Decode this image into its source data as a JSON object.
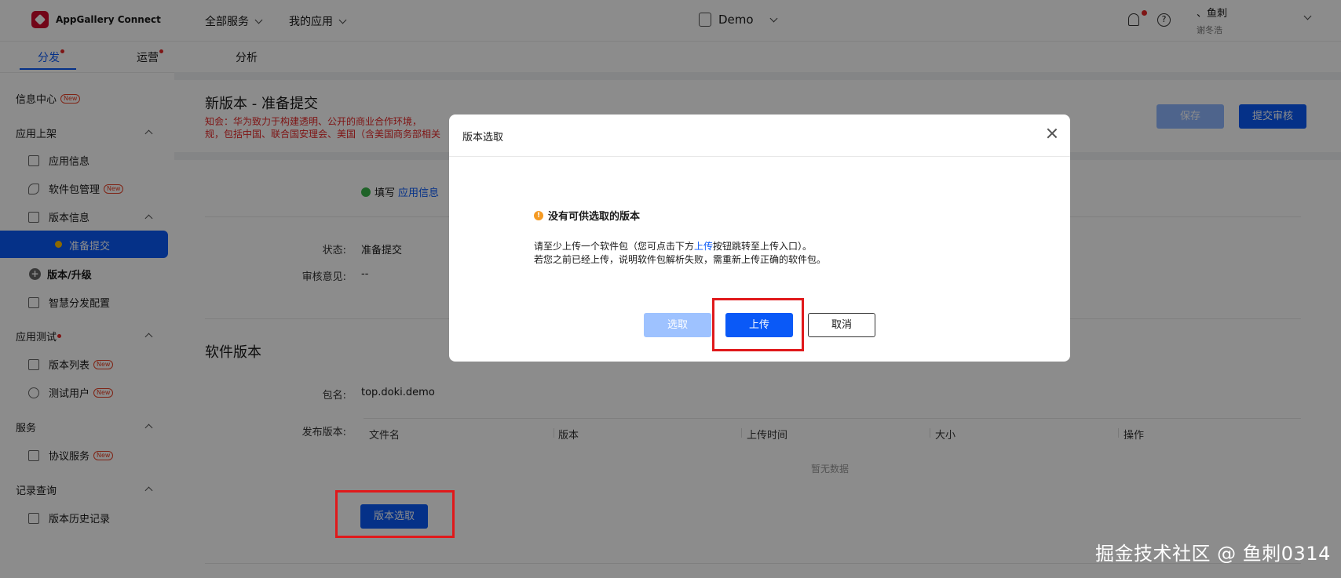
{
  "header": {
    "logo_text": "AppGallery Connect",
    "menu_all_services": "全部服务",
    "menu_my_apps": "我的应用",
    "app_name": "Demo",
    "help_glyph": "?",
    "user_name": "、鱼刺",
    "user_sub": "谢冬浩"
  },
  "tabs": [
    {
      "label": "分发",
      "active": true,
      "dot": true
    },
    {
      "label": "运营",
      "active": false,
      "dot": true
    },
    {
      "label": "分析",
      "active": false,
      "dot": false
    }
  ],
  "sidebar": {
    "info_center": "信息中心",
    "new_badge": "New",
    "group_app_listing": "应用上架",
    "app_info": "应用信息",
    "package_mgmt": "软件包管理",
    "version_info": "版本信息",
    "prepare_submit": "准备提交",
    "version_upgrade": "版本/升级",
    "smart_dist": "智慧分发配置",
    "group_app_test": "应用测试",
    "version_list": "版本列表",
    "test_users": "测试用户",
    "group_services": "服务",
    "agreement_service": "协议服务",
    "group_records": "记录查询",
    "version_history": "版本历史记录"
  },
  "page": {
    "title": "新版本 - 准备提交",
    "notice_line1": "知会：华为致力于构建透明、公开的商业合作环境，",
    "notice_line2": "规，包括中国、联合国安理会、美国（含美国商务部相关",
    "save_label": "保存",
    "submit_label": "提交审核",
    "step_fill": "填写",
    "step_link": "应用信息",
    "status_label": "状态:",
    "status_value": "准备提交",
    "review_label": "审核意见:",
    "review_value": "--",
    "section_software_version": "软件版本",
    "package_label": "包名:",
    "package_value": "top.doki.demo",
    "release_label": "发布版本:",
    "table_headers": [
      "文件名",
      "版本",
      "上传时间",
      "大小",
      "操作"
    ],
    "no_data": "暂无数据",
    "version_pick_label": "版本选取"
  },
  "modal": {
    "title": "版本选取",
    "warn_title": "没有可供选取的版本",
    "msg_part1": "请至少上传一个软件包（您可点击下方",
    "msg_link": "上传",
    "msg_part2": "按钮跳转至上传入口）。",
    "msg_line2": "若您之前已经上传，说明软件包解析失败，需重新上传正确的软件包。",
    "select_label": "选取",
    "upload_label": "上传",
    "cancel_label": "取消"
  },
  "watermark": "掘金技术社区 @ 鱼刺0314",
  "colors": {
    "primary": "#0a59f7",
    "danger": "#e62727",
    "warning": "#f59a23",
    "highlight_box": "#e0191b"
  }
}
